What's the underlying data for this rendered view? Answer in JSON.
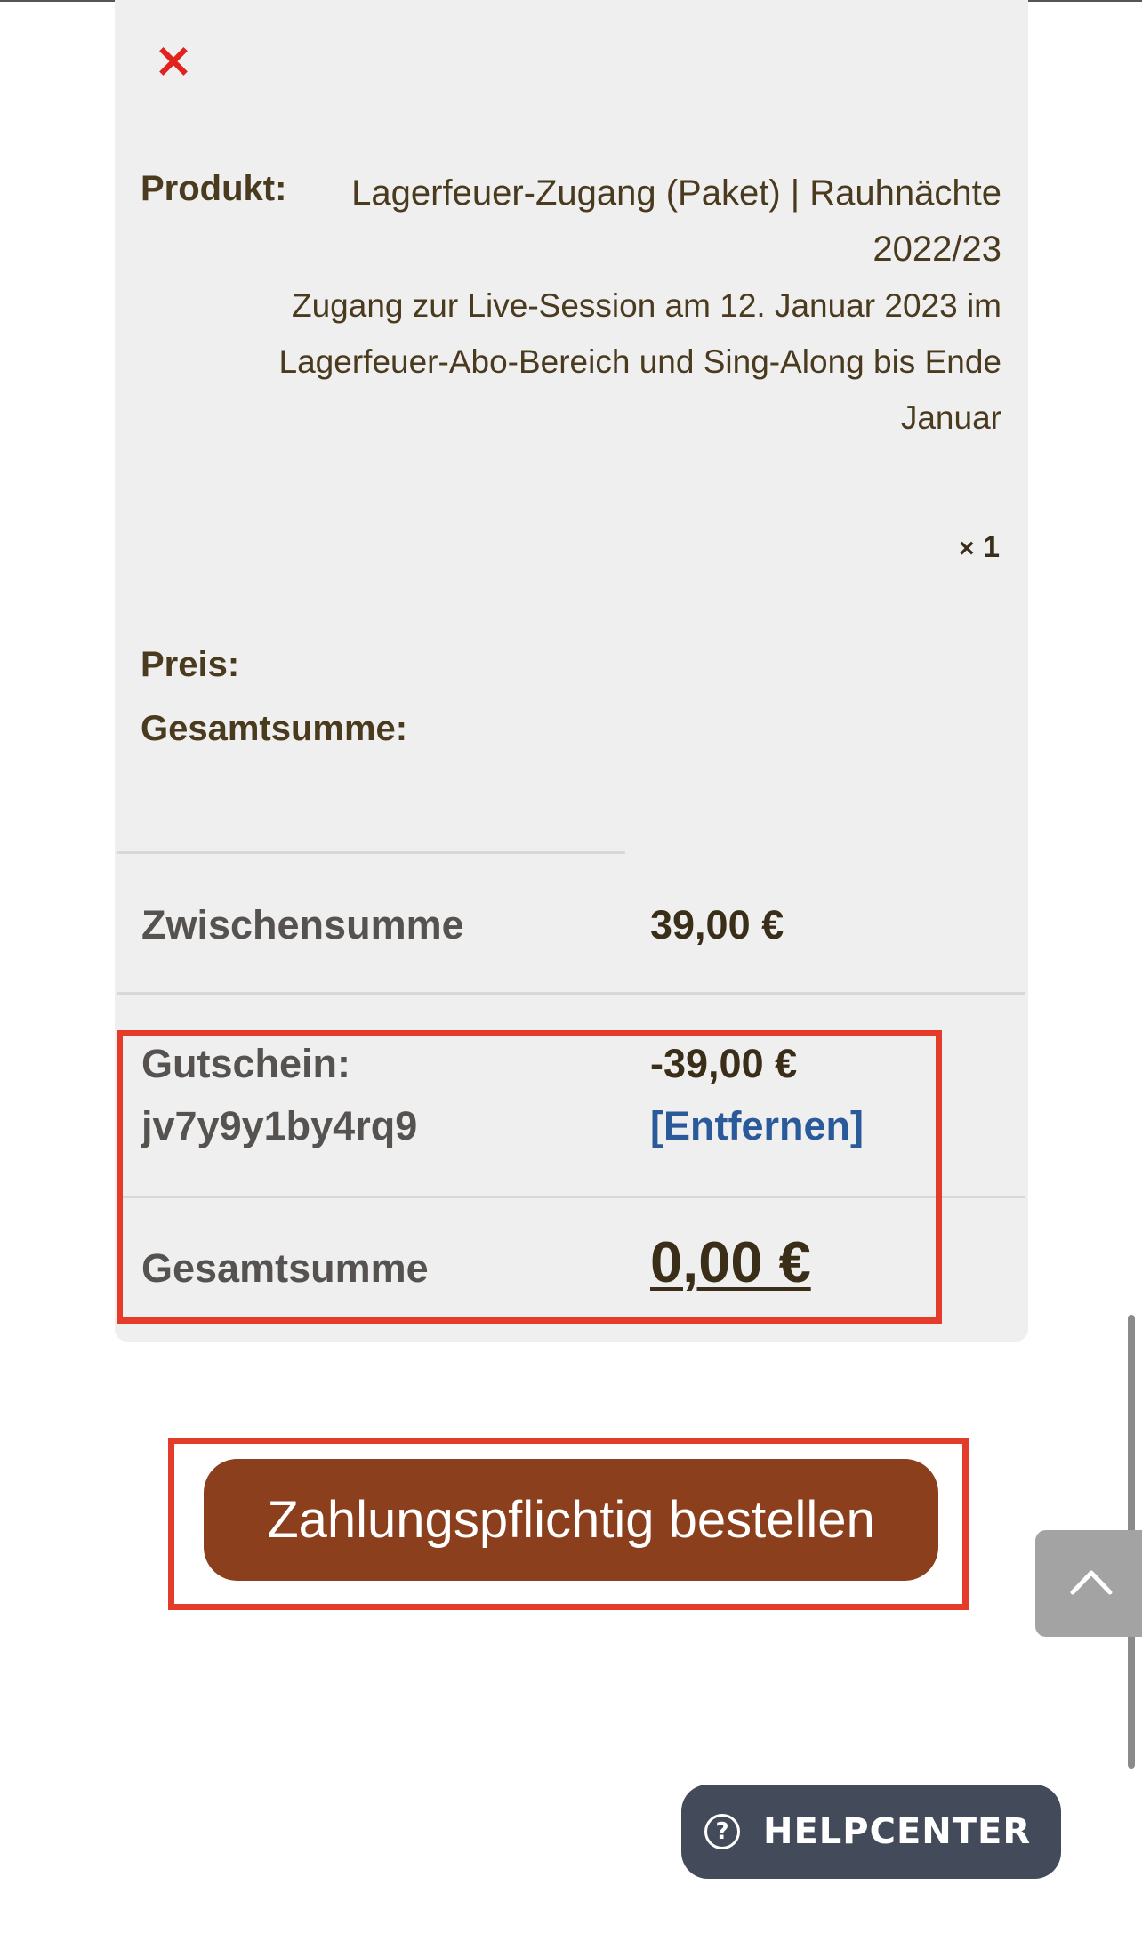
{
  "cart_item": {
    "remove_icon": "×",
    "product_label": "Produkt:",
    "product_name": "Lagerfeuer-Zugang (Paket) | Rauhnächte 2022/23",
    "product_description": "Zugang zur Live-Session am 12. Januar 2023 im Lagerfeuer-Abo-Bereich und Sing-Along bis Ende Januar",
    "quantity_prefix": "×",
    "quantity": "1",
    "price_label": "Preis:",
    "total_label": "Gesamtsumme:"
  },
  "totals": {
    "subtotal_label": "Zwischensumme",
    "subtotal_value": "39,00 €",
    "coupon_label": "Gutschein:",
    "coupon_code": "jv7y9y1by4rq9",
    "coupon_value": "-39,00 €",
    "coupon_remove": "[Entfernen]",
    "grand_total_label": "Gesamtsumme",
    "grand_total_value": "0,00 €"
  },
  "actions": {
    "order_button": "Zahlungspflichtig bestellen"
  },
  "helpcenter": {
    "label": "HELPCENTER",
    "icon": "?"
  },
  "colors": {
    "order_button": "#8b3f1c",
    "highlight": "#e53b2a",
    "link": "#2b5a9a",
    "helpcenter_bg": "#434b5a",
    "remove_icon": "#e0231c"
  },
  "icons": {
    "remove": "close-icon",
    "back_to_top": "chevron-up-icon",
    "help": "question-circle-icon"
  }
}
